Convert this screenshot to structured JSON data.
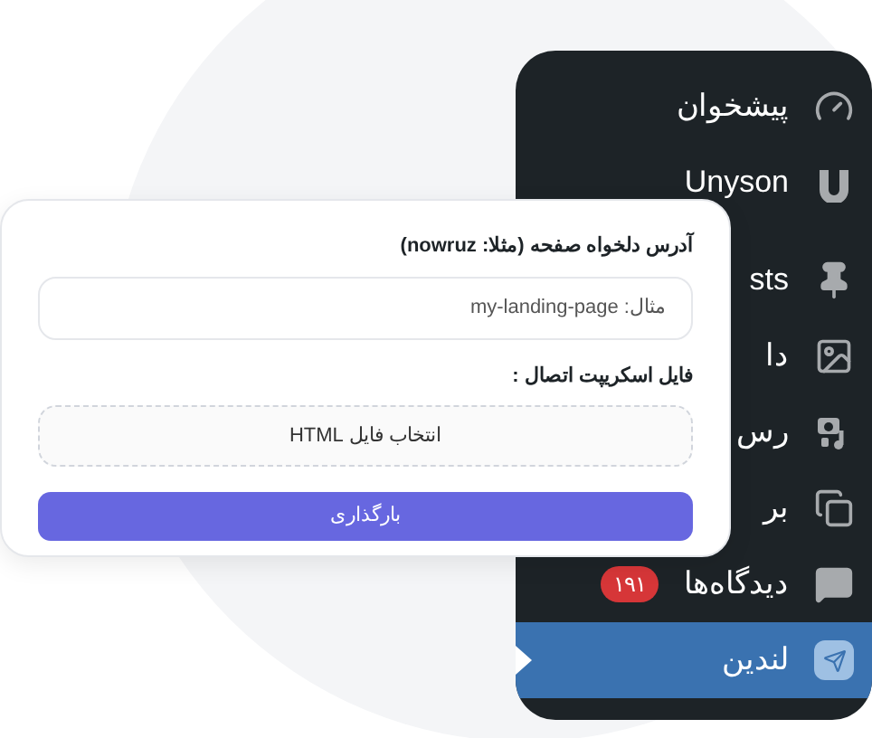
{
  "sidebar": {
    "items": [
      {
        "label": "پیشخوان",
        "selected": false
      },
      {
        "label": "Unyson",
        "selected": false
      },
      {
        "label": "sts",
        "selected": false
      },
      {
        "label": "دا",
        "selected": false
      },
      {
        "label": "رس",
        "selected": false
      },
      {
        "label": "بر",
        "selected": false
      },
      {
        "label": "دیدگاه‌ها",
        "selected": false,
        "badge": "۱۹۱"
      },
      {
        "label": "لندین",
        "selected": true
      }
    ]
  },
  "form": {
    "url_label": "آدرس دلخواه صفحه (مثلا: nowruz)",
    "url_field": {
      "placeholder": "مثال: my-landing-page"
    },
    "file_label": "فایل اسکریپت اتصال :",
    "file_button": "انتخاب فایل HTML",
    "submit_button": "بارگذاری"
  }
}
